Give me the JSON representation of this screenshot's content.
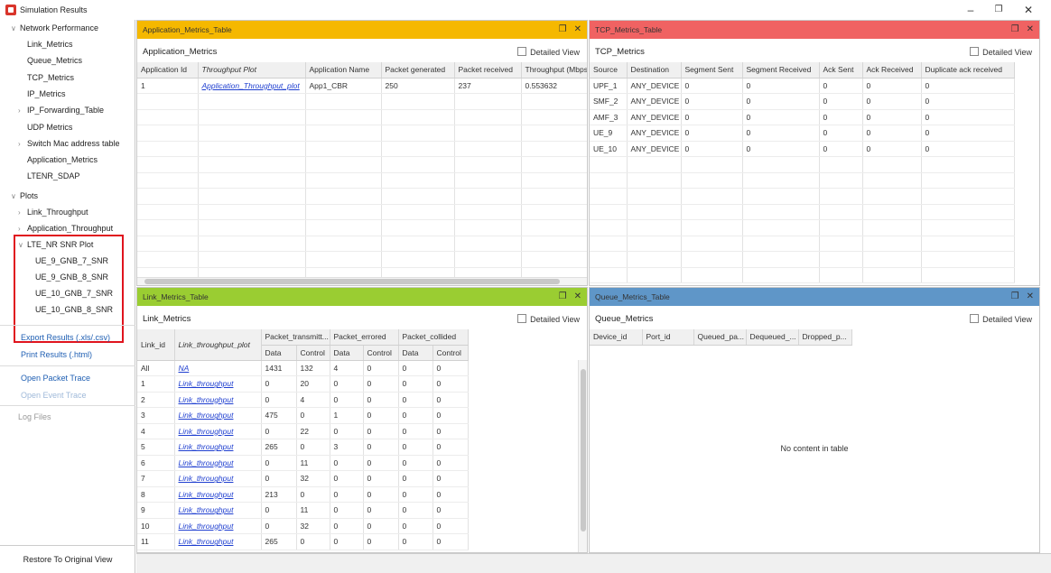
{
  "window": {
    "title": "Simulation Results",
    "minimize": "–",
    "restore": "❐",
    "close": "✕"
  },
  "sidebar": {
    "network_performance": {
      "label": "Network Performance",
      "expanded": true
    },
    "network_items": [
      {
        "label": "Link_Metrics",
        "has_children": false
      },
      {
        "label": "Queue_Metrics",
        "has_children": false
      },
      {
        "label": "TCP_Metrics",
        "has_children": false
      },
      {
        "label": "IP_Metrics",
        "has_children": false
      },
      {
        "label": "IP_Forwarding_Table",
        "has_children": true
      },
      {
        "label": "UDP Metrics",
        "has_children": false
      },
      {
        "label": "Switch Mac address table",
        "has_children": true
      },
      {
        "label": "Application_Metrics",
        "has_children": false
      },
      {
        "label": "LTENR_SDAP",
        "has_children": false
      }
    ],
    "plots": {
      "label": "Plots",
      "expanded": true
    },
    "plot_items": [
      {
        "label": "Link_Throughput"
      },
      {
        "label": "Application_Throughput"
      }
    ],
    "snr_plot": {
      "label": "LTE_NR SNR Plot"
    },
    "snr_items": [
      "UE_9_GNB_7_SNR",
      "UE_9_GNB_8_SNR",
      "UE_10_GNB_7_SNR",
      "UE_10_GNB_8_SNR"
    ],
    "links": {
      "export": "Export Results (.xls/.csv)",
      "print": "Print Results (.html)",
      "packet_trace": "Open Packet Trace",
      "event_trace": "Open Event Trace"
    },
    "log_files": "Log Files",
    "restore": "Restore To Original View"
  },
  "app_panel": {
    "header": "Application_Metrics_Table",
    "header_color": "#f5b800",
    "title": "Application_Metrics",
    "detailed_view": "Detailed View",
    "columns": [
      "Application Id",
      "Throughput Plot",
      "Application Name",
      "Packet generated",
      "Packet received",
      "Throughput (Mbps)"
    ],
    "rows": [
      [
        "1",
        "Application_Throughput_plot",
        "App1_CBR",
        "250",
        "237",
        "0.553632"
      ]
    ]
  },
  "tcp_panel": {
    "header": "TCP_Metrics_Table",
    "header_color": "#f06262",
    "title": "TCP_Metrics",
    "detailed_view": "Detailed View",
    "columns": [
      "Source",
      "Destination",
      "Segment Sent",
      "Segment Received",
      "Ack Sent",
      "Ack Received",
      "Duplicate ack received"
    ],
    "rows": [
      [
        "UPF_1",
        "ANY_DEVICE",
        "0",
        "0",
        "0",
        "0",
        "0"
      ],
      [
        "SMF_2",
        "ANY_DEVICE",
        "0",
        "0",
        "0",
        "0",
        "0"
      ],
      [
        "AMF_3",
        "ANY_DEVICE",
        "0",
        "0",
        "0",
        "0",
        "0"
      ],
      [
        "UE_9",
        "ANY_DEVICE",
        "0",
        "0",
        "0",
        "0",
        "0"
      ],
      [
        "UE_10",
        "ANY_DEVICE",
        "0",
        "0",
        "0",
        "0",
        "0"
      ]
    ]
  },
  "link_panel": {
    "header": "Link_Metrics_Table",
    "header_color": "#9acd32",
    "title": "Link_Metrics",
    "detailed_view": "Detailed View",
    "columns_top": [
      "Link_id",
      "Link_throughput_plot",
      "Packet_transmitt...",
      "Packet_errored",
      "Packet_collided"
    ],
    "columns_sub": [
      "Data",
      "Control",
      "Data",
      "Control",
      "Data",
      "Control"
    ],
    "rows": [
      [
        "All",
        "NA",
        "1431",
        "132",
        "4",
        "0",
        "0",
        "0"
      ],
      [
        "1",
        "Link_throughput",
        "0",
        "20",
        "0",
        "0",
        "0",
        "0"
      ],
      [
        "2",
        "Link_throughput",
        "0",
        "4",
        "0",
        "0",
        "0",
        "0"
      ],
      [
        "3",
        "Link_throughput",
        "475",
        "0",
        "1",
        "0",
        "0",
        "0"
      ],
      [
        "4",
        "Link_throughput",
        "0",
        "22",
        "0",
        "0",
        "0",
        "0"
      ],
      [
        "5",
        "Link_throughput",
        "265",
        "0",
        "3",
        "0",
        "0",
        "0"
      ],
      [
        "6",
        "Link_throughput",
        "0",
        "11",
        "0",
        "0",
        "0",
        "0"
      ],
      [
        "7",
        "Link_throughput",
        "0",
        "32",
        "0",
        "0",
        "0",
        "0"
      ],
      [
        "8",
        "Link_throughput",
        "213",
        "0",
        "0",
        "0",
        "0",
        "0"
      ],
      [
        "9",
        "Link_throughput",
        "0",
        "11",
        "0",
        "0",
        "0",
        "0"
      ],
      [
        "10",
        "Link_throughput",
        "0",
        "32",
        "0",
        "0",
        "0",
        "0"
      ],
      [
        "11",
        "Link_throughput",
        "265",
        "0",
        "0",
        "0",
        "0",
        "0"
      ]
    ]
  },
  "queue_panel": {
    "header": "Queue_Metrics_Table",
    "header_color": "#5f96c8",
    "title": "Queue_Metrics",
    "detailed_view": "Detailed View",
    "columns": [
      "Device_id",
      "Port_id",
      "Queued_pa...",
      "Dequeued_...",
      "Dropped_p..."
    ],
    "empty_message": "No content in table"
  },
  "panel_controls": {
    "float": "❐",
    "close": "✕"
  },
  "icons": [
    "app-icon",
    "tree-arrow-icon",
    "checkbox-icon",
    "float-icon",
    "close-icon"
  ]
}
